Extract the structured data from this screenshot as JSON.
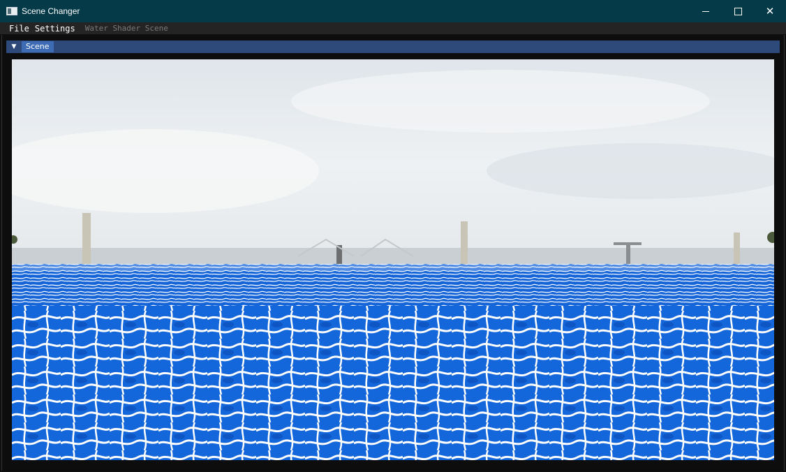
{
  "window": {
    "title": "Scene Changer",
    "icon": "app-window-icon",
    "controls": {
      "minimize": "minimize-icon",
      "maximize": "maximize-icon",
      "close": "close-icon"
    }
  },
  "menubar": {
    "items": [
      "File",
      "Settings"
    ],
    "current_scene": "Water Shader Scene"
  },
  "panel": {
    "tab_label": "Scene",
    "collapse_icon": "collapse-arrow-icon"
  },
  "viewport": {
    "content": "water-shader-render",
    "colors": {
      "sky": "#e6ecef",
      "water": "#1468dc",
      "caustics": "#ffffff"
    }
  }
}
